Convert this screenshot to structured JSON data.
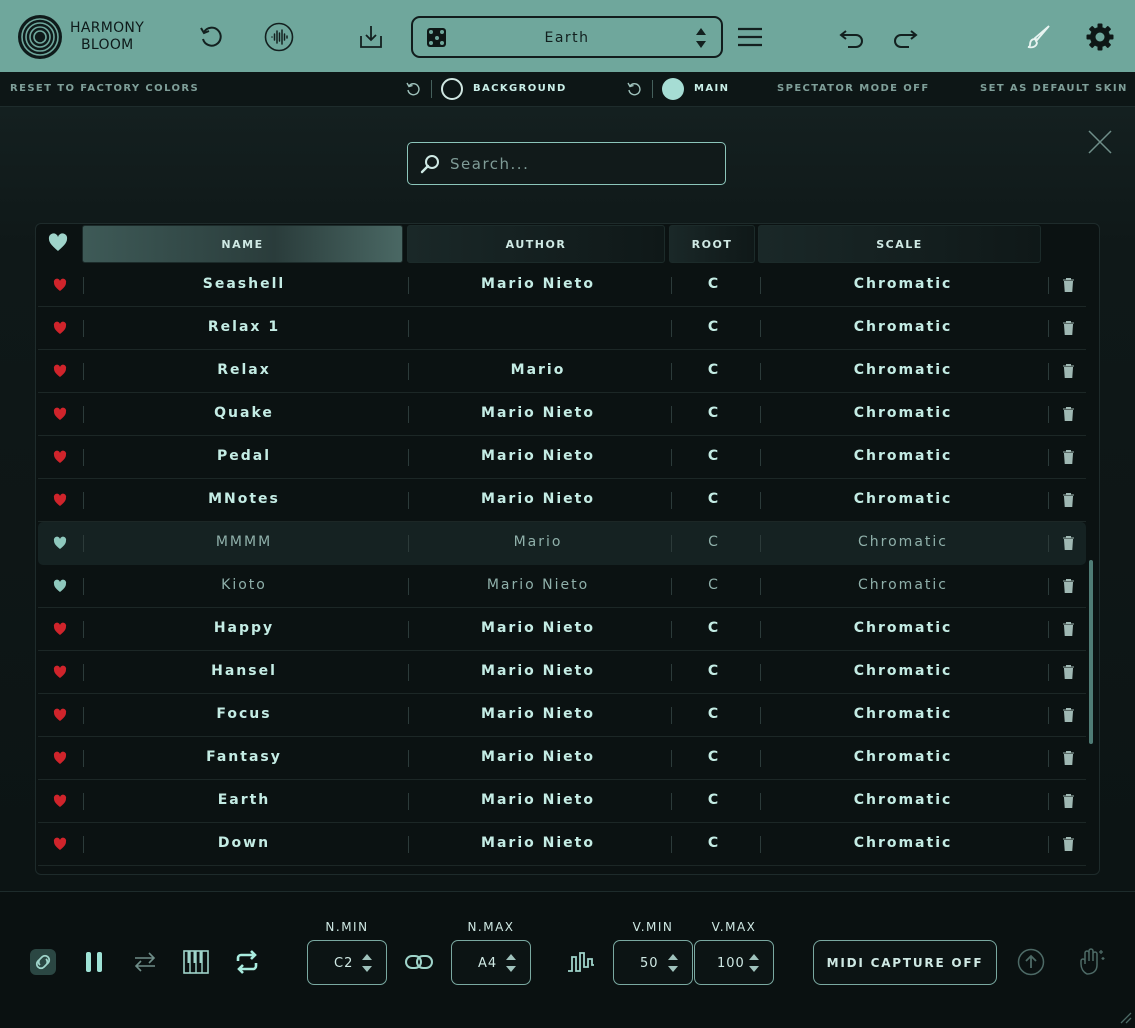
{
  "app": {
    "brand_line1": "HARMONY",
    "brand_line2": "BLOOM",
    "preset_name": "Earth",
    "accent_color": "#6fa79c",
    "icons": [
      "logo-rings-icon",
      "reset-icon",
      "waveform-icon",
      "download-icon",
      "dice-icon",
      "updown-arrows-icon",
      "menu-icon",
      "undo-icon",
      "redo-icon",
      "brush-icon",
      "gear-icon"
    ]
  },
  "skin": {
    "reset_factory": "RESET TO FACTORY COLORS",
    "background_label": "BACKGROUND",
    "main_label": "MAIN",
    "spectator": "SPECTATOR MODE OFF",
    "set_default": "SET AS DEFAULT SKIN"
  },
  "browser": {
    "search_placeholder": "Search...",
    "columns": {
      "name": "NAME",
      "author": "AUTHOR",
      "root": "ROOT",
      "scale": "SCALE"
    },
    "rows": [
      {
        "name": "Seashell",
        "author": "Mario Nieto",
        "root": "C",
        "scale": "Chromatic",
        "favorite": true
      },
      {
        "name": "Relax 1",
        "author": "",
        "root": "C",
        "scale": "Chromatic",
        "favorite": true
      },
      {
        "name": "Relax",
        "author": "Mario",
        "root": "C",
        "scale": "Chromatic",
        "favorite": true
      },
      {
        "name": "Quake",
        "author": "Mario Nieto",
        "root": "C",
        "scale": "Chromatic",
        "favorite": true
      },
      {
        "name": "Pedal",
        "author": "Mario Nieto",
        "root": "C",
        "scale": "Chromatic",
        "favorite": true
      },
      {
        "name": "MNotes",
        "author": "Mario Nieto",
        "root": "C",
        "scale": "Chromatic",
        "favorite": true
      },
      {
        "name": "MMMM",
        "author": "Mario",
        "root": "C",
        "scale": "Chromatic",
        "favorite": false
      },
      {
        "name": "Kioto",
        "author": "Mario Nieto",
        "root": "C",
        "scale": "Chromatic",
        "favorite": false
      },
      {
        "name": "Happy",
        "author": "Mario Nieto",
        "root": "C",
        "scale": "Chromatic",
        "favorite": true
      },
      {
        "name": "Hansel",
        "author": "Mario Nieto",
        "root": "C",
        "scale": "Chromatic",
        "favorite": true
      },
      {
        "name": "Focus",
        "author": "Mario Nieto",
        "root": "C",
        "scale": "Chromatic",
        "favorite": true
      },
      {
        "name": "Fantasy",
        "author": "Mario Nieto",
        "root": "C",
        "scale": "Chromatic",
        "favorite": true
      },
      {
        "name": "Earth",
        "author": "Mario Nieto",
        "root": "C",
        "scale": "Chromatic",
        "favorite": true
      },
      {
        "name": "Down",
        "author": "Mario Nieto",
        "root": "C",
        "scale": "Chromatic",
        "favorite": true
      }
    ],
    "selected_index": 6,
    "favorite_color": "#d0242b",
    "nonfavorite_color": "#8ec8bd"
  },
  "controls": {
    "n_min_label": "N.MIN",
    "n_min": "C2",
    "n_max_label": "N.MAX",
    "n_max": "A4",
    "v_min_label": "V.MIN",
    "v_min": "50",
    "v_max_label": "V.MAX",
    "v_max": "100",
    "midi_capture": "MIDI CAPTURE OFF"
  }
}
